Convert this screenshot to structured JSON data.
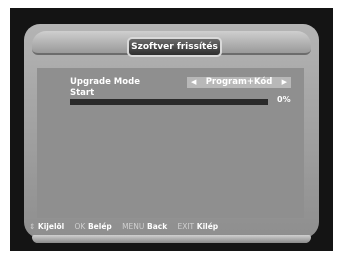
{
  "header": {
    "title": "Szoftver frissítés"
  },
  "form": {
    "mode_label": "Upgrade Mode",
    "mode_value": "Program+Kód",
    "start_label": "Start",
    "progress_percent": 0,
    "progress_text": "0%"
  },
  "footer": {
    "select_icon": "⇕",
    "select_label": "Kijelöl",
    "ok_key": "OK",
    "ok_label": "Belép",
    "menu_key": "MENU",
    "menu_label": "Back",
    "exit_key": "EXIT",
    "exit_label": "Kilép"
  },
  "colors": {
    "frame": "#a8a8a8",
    "panel": "#8f8f8f",
    "progress_bg": "#2a2a2a"
  }
}
